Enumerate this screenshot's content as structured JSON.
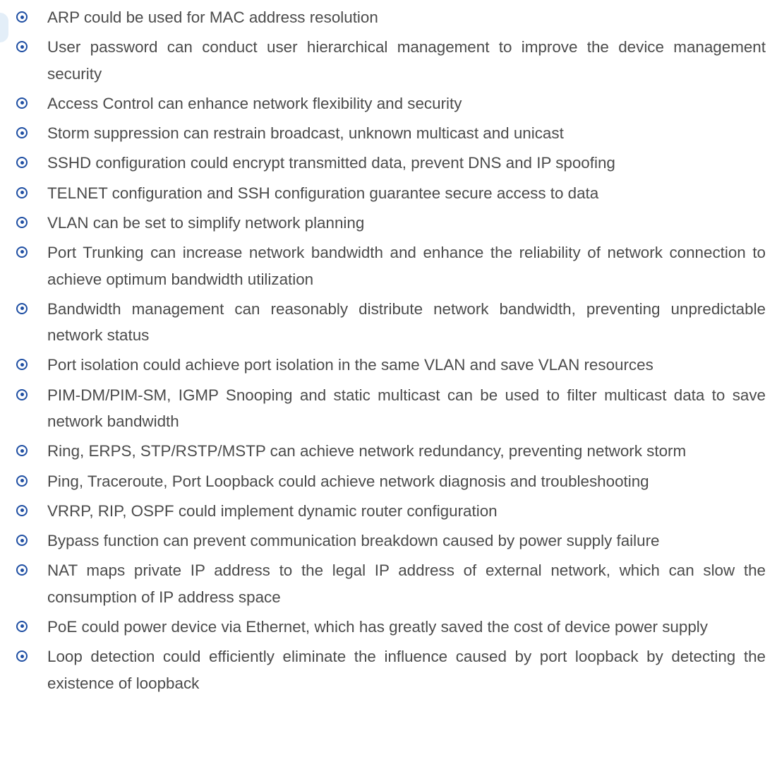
{
  "features": [
    "ARP could be used for MAC address resolution",
    "User password can conduct user hierarchical management to improve the device management security",
    "Access Control can enhance network flexibility and security",
    "Storm suppression can restrain broadcast, unknown multicast and unicast",
    "SSHD configuration could encrypt transmitted data, prevent DNS and IP spoofing",
    "TELNET configuration and SSH configuration guarantee secure access to data",
    "VLAN can be set to simplify network planning",
    "Port Trunking can increase network bandwidth and enhance the reliability of network connection to achieve optimum bandwidth utilization",
    "Bandwidth management can reasonably distribute network bandwidth, preventing unpredictable network status",
    "Port isolation could achieve port isolation in the same VLAN and save VLAN resources",
    "PIM-DM/PIM-SM, IGMP Snooping and static multicast can be used to filter multicast data to save network bandwidth",
    "Ring, ERPS, STP/RSTP/MSTP can achieve network redundancy, preventing network storm",
    "Ping, Traceroute, Port Loopback could achieve network diagnosis and troubleshooting",
    "VRRP, RIP, OSPF could implement dynamic router configuration",
    "Bypass function can prevent communication breakdown caused by power supply failure",
    "NAT maps private IP address to the legal IP address of external network, which can slow the consumption of IP address space",
    "PoE could power device via Ethernet, which has greatly saved the cost of device power supply",
    "Loop detection could efficiently eliminate the influence caused by port loopback by detecting the existence of loopback"
  ],
  "colors": {
    "bullet": "#1f4fa3",
    "text": "#4b4b4b",
    "edge_tab": "#e3eef8"
  },
  "icons": {
    "bullet": "circled-dot-bullet-icon"
  }
}
